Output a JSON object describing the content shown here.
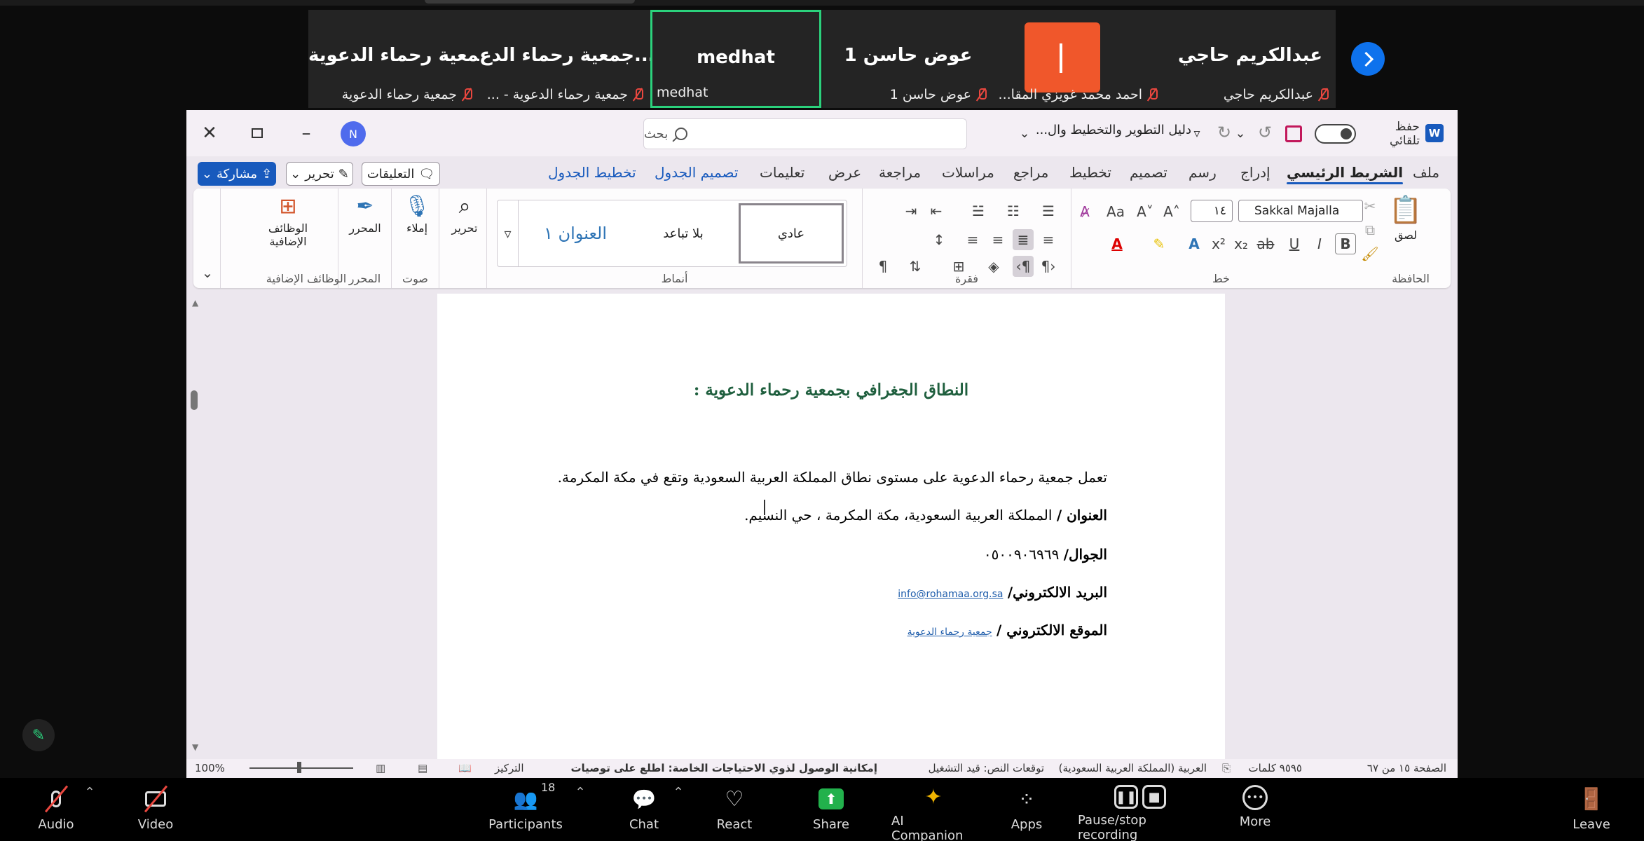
{
  "gallery": {
    "tiles": [
      {
        "name": "عبدالكريم حاجي",
        "label": "عبدالكريم حاجي"
      },
      {
        "name": "",
        "label": "احمد محمد غويزي المقا..."
      },
      {
        "name": "عوض حاسن 1",
        "label": "عوض حاسن 1"
      },
      {
        "name": "medhat",
        "label": "medhat"
      },
      {
        "name": "جمعية رحماء الدع...",
        "label": "جمعية رحماء الدعوية - ..."
      },
      {
        "name": "جمعية رحماء الدعوية",
        "label": "جمعية رحماء الدعوية"
      }
    ]
  },
  "word": {
    "title_bar": {
      "autosave_label": "حفظ تلقائي",
      "doc_name": "دليل التطوير والتخطيط وال...",
      "search_placeholder": "بحث",
      "user_initial": "N"
    },
    "tabs": [
      "ملف",
      "الشريط الرئيسي",
      "إدراج",
      "رسم",
      "تصميم",
      "تخطيط",
      "مراجع",
      "مراسلات",
      "مراجعة",
      "عرض",
      "تعليمات",
      "تصميم الجدول",
      "تخطيط الجدول"
    ],
    "active_tab": "الشريط الرئيسي",
    "ribbon_buttons": {
      "comments": "التعليقات",
      "editing": "تحرير",
      "share": "مشاركة"
    },
    "ribbon": {
      "clipboard": {
        "label": "الحافظة",
        "paste": "لصق"
      },
      "font": {
        "label": "خط",
        "font_name": "Sakkal Majalla",
        "font_size": "١٤"
      },
      "paragraph": {
        "label": "فقرة"
      },
      "styles": {
        "label": "أنماط",
        "items": [
          "عادي",
          "بلا تباعد",
          "العنوان ١"
        ]
      },
      "editing": {
        "label": "تحرير"
      },
      "voice": {
        "label": "صوت",
        "dictate": "إملاء"
      },
      "editor": {
        "label": "المحرر",
        "editor_btn": "المحرر"
      },
      "addins": {
        "label": "الوظائف الإضافية",
        "addins_btn": "الوظائف الإضافية"
      }
    },
    "document": {
      "title": "النطاق الجغرافي بجمعية رحماء الدعوية :",
      "para1": "تعمل جمعية رحماء الدعوية على مستوى نطاق المملكة العربية السعودية وتقع في مكة المكرمة.",
      "address_label": "العنوان /",
      "address_value": " المملكة العربية السعودية، مكة المكرمة ، حي النسيم.",
      "mobile_label": "الجوال/",
      "mobile_value": " ٠٥٠٠٩٠٦٩٦٩",
      "email_label": "البريد الالكتروني/",
      "email_value": "info@rohamaa.org.sa",
      "website_label": "الموقع الالكتروني /",
      "website_value": "جمعية رحماء الدعوية"
    },
    "status_bar": {
      "page": "الصفحة ١٥ من ٦٧",
      "words": "٩٥٩٥ كلمات",
      "language": "العربية (المملكة العربية السعودية)",
      "predictions": "توقعات النص: قيد التشغيل",
      "accessibility": "إمكانية الوصول لذوي الاحتياجات الخاصة: اطلع على توصيات",
      "focus": "التركيز",
      "zoom": "100%"
    }
  },
  "toolbar": {
    "audio": "Audio",
    "video": "Video",
    "participants": "Participants",
    "participants_count": "18",
    "chat": "Chat",
    "react": "React",
    "share": "Share",
    "ai": "AI Companion",
    "apps": "Apps",
    "recording": "Pause/stop recording",
    "more": "More",
    "leave": "Leave"
  },
  "colors": {
    "active_speaker": "#2bd17c",
    "share_green": "#22b14c",
    "word_blue": "#185abd",
    "title_green": "#1f5f3e"
  }
}
